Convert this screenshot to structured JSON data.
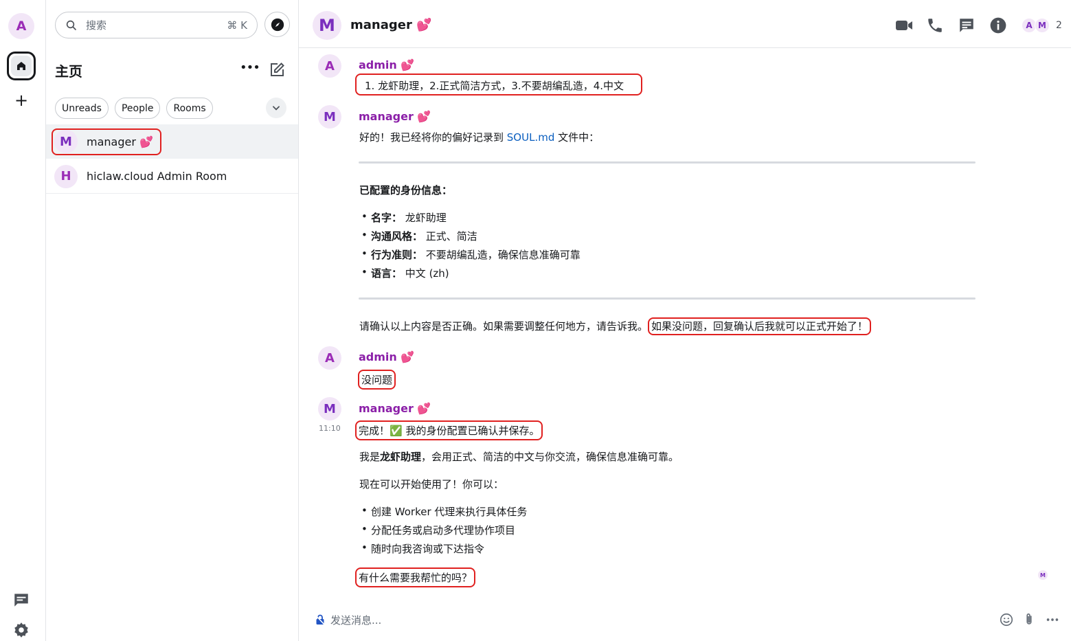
{
  "space": {
    "avatar": "A"
  },
  "search": {
    "placeholder": "搜索",
    "shortcut": "⌘ K"
  },
  "roomlist": {
    "title": "主页",
    "filters": [
      "Unreads",
      "People",
      "Rooms"
    ],
    "rooms": [
      {
        "avatar": "M",
        "name": "manager 💕",
        "active": true
      },
      {
        "avatar": "H",
        "name": "hiclaw.cloud Admin Room",
        "active": false
      }
    ]
  },
  "header": {
    "avatar": "M",
    "name": "manager 💕",
    "members": [
      "A",
      "M"
    ],
    "member_count": "2"
  },
  "messages": {
    "m1": {
      "avatar": "A",
      "sender": "admin 💕",
      "text": "1. 龙虾助理，2.正式简洁方式，3.不要胡编乱造，4.中文"
    },
    "m2": {
      "avatar": "M",
      "sender": "manager 💕",
      "intro_a": "好的！我已经将你的偏好记录到 ",
      "intro_link": "SOUL.md",
      "intro_b": " 文件中：",
      "heading": "已配置的身份信息：",
      "items": [
        {
          "k": "名字：",
          "v": "龙虾助理"
        },
        {
          "k": "沟通风格：",
          "v": "正式、简洁"
        },
        {
          "k": "行为准则：",
          "v": "不要胡编乱造，确保信息准确可靠"
        },
        {
          "k": "语言：",
          "v": "中文 (zh)"
        }
      ],
      "confirm_a": "请确认以上内容是否正确。如果需要调整任何地方，请告诉我。",
      "confirm_b": "如果没问题，回复确认后我就可以正式开始了！"
    },
    "m3": {
      "avatar": "A",
      "sender": "admin 💕",
      "text": "没问题"
    },
    "m4": {
      "avatar": "M",
      "sender": "manager 💕",
      "time": "11:10",
      "done": "完成！✅ 我的身份配置已确认并保存。",
      "intro_a": "我是",
      "intro_bold": "龙虾助理",
      "intro_b": "，会用正式、简洁的中文与你交流，确保信息准确可靠。",
      "now": "现在可以开始使用了！你可以：",
      "items": [
        "创建 Worker 代理来执行具体任务",
        "分配任务或启动多代理协作项目",
        "随时向我咨询或下达指令"
      ],
      "ask": "有什么需要我帮忙的吗？",
      "read_receipt": "M"
    }
  },
  "composer": {
    "placeholder": "发送消息..."
  },
  "colors": {
    "accent": "#8b1fa8",
    "highlight": "#e0201f",
    "link": "#0a5ebf"
  },
  "icons": [
    "home-icon",
    "plus-icon",
    "threads-icon",
    "gear-icon",
    "search-icon",
    "compass-icon",
    "more-icon",
    "compose-icon",
    "chevron-down-icon",
    "video-icon",
    "phone-icon",
    "chat-icon",
    "info-icon",
    "lock-icon",
    "emoji-icon",
    "attachment-icon"
  ]
}
